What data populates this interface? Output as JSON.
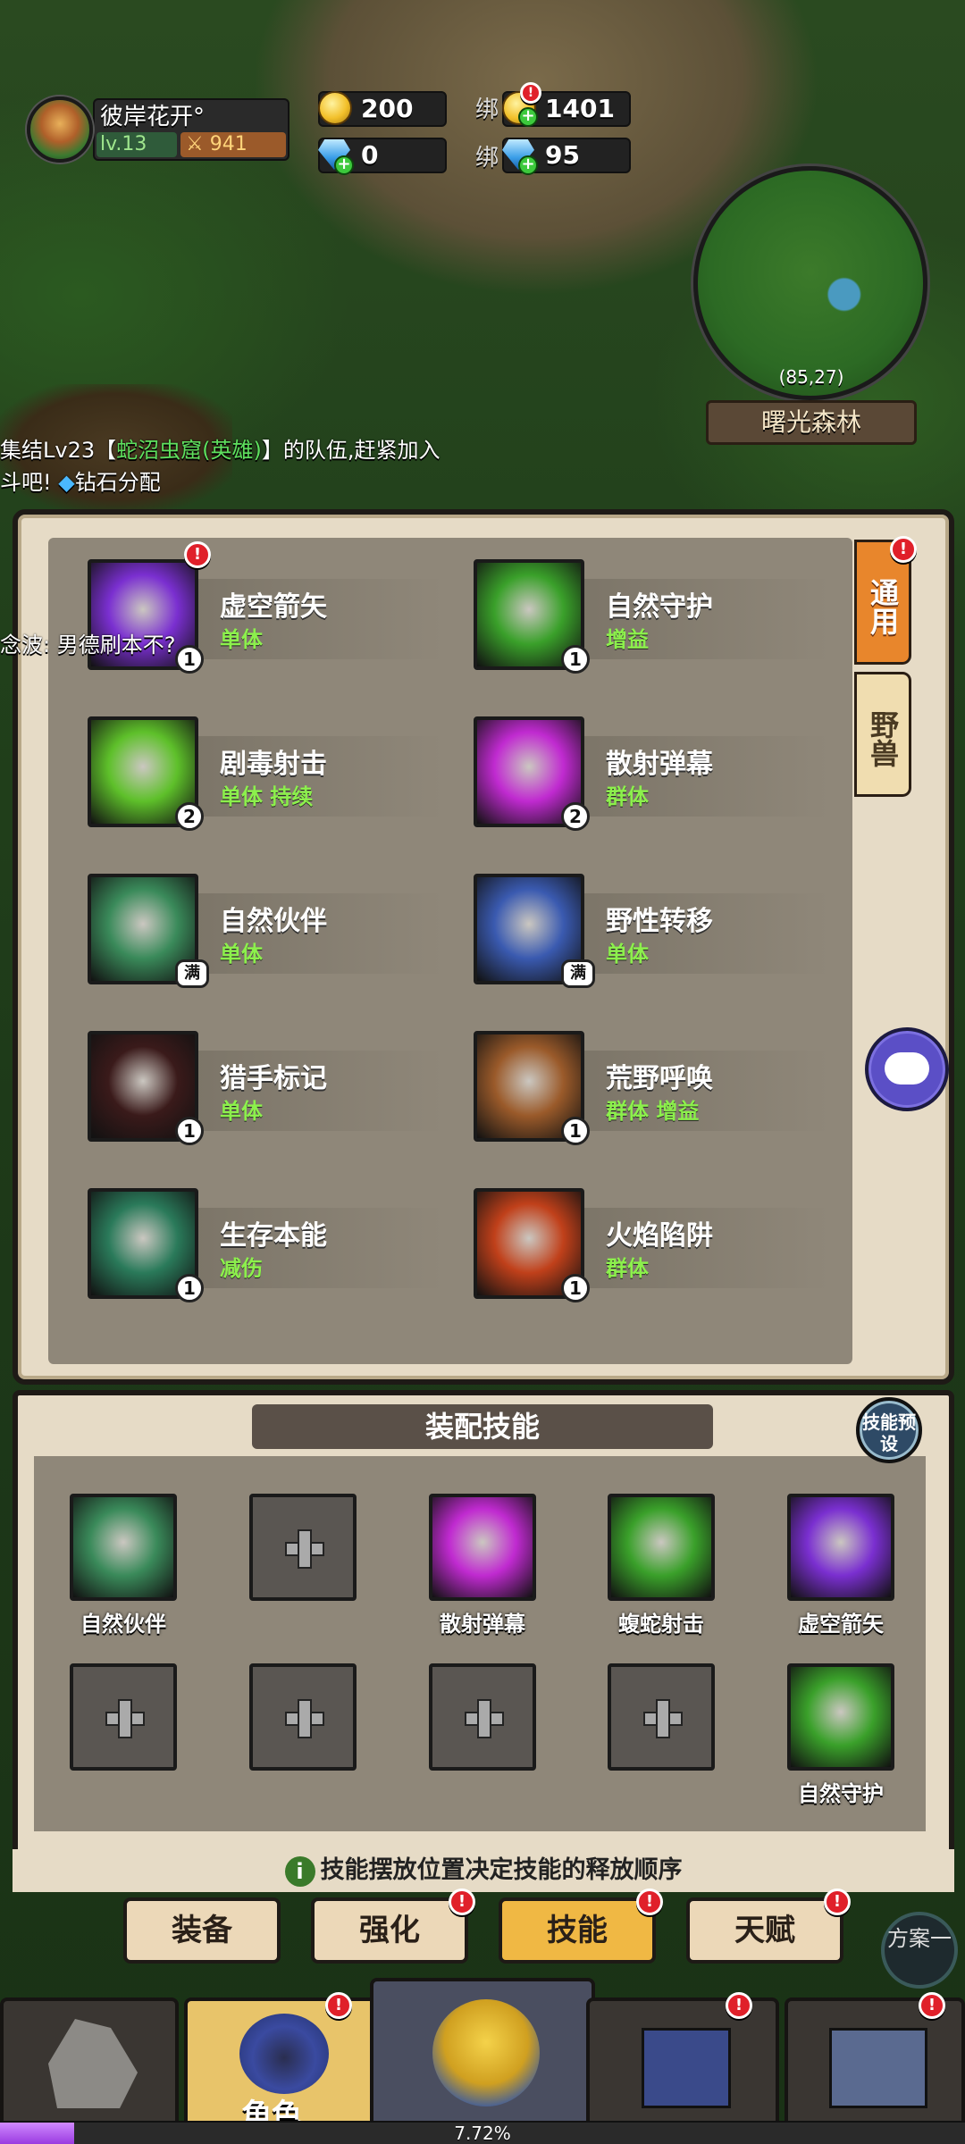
{
  "player": {
    "name": "彼岸花开°",
    "level": "lv.13",
    "power": "941"
  },
  "currency": {
    "gold": "200",
    "diamond": "0",
    "bound_label": "绑",
    "bound_gold": "1401",
    "bound_diamond": "95"
  },
  "map": {
    "coords": "(85,27)",
    "name": "曙光森林"
  },
  "chat": {
    "line1_prefix": "集结Lv23【",
    "line1_highlight": "蛇沼虫窟(英雄)",
    "line1_suffix": "】的队伍,赶紧加入",
    "line2_a": "斗吧!",
    "line2_b": "钻石分配",
    "line3": "念波: 男德刷本不?"
  },
  "side_tabs": [
    {
      "label": "通用"
    },
    {
      "label": "野兽"
    }
  ],
  "skills": [
    {
      "name": "虚空箭矢",
      "tags": "单体",
      "level": "1",
      "alert": true,
      "color": "#7a2fd0"
    },
    {
      "name": "自然守护",
      "tags": "增益",
      "level": "1",
      "alert": false,
      "color": "#3aa02a"
    },
    {
      "name": "剧毒射击",
      "tags": "单体 持续",
      "level": "2",
      "alert": false,
      "color": "#5ec02a"
    },
    {
      "name": "散射弹幕",
      "tags": "群体",
      "level": "2",
      "alert": false,
      "color": "#c02ad0"
    },
    {
      "name": "自然伙伴",
      "tags": "单体",
      "level": "满",
      "alert": false,
      "color": "#3a8a5a"
    },
    {
      "name": "野性转移",
      "tags": "单体",
      "level": "满",
      "alert": false,
      "color": "#3a5ab0"
    },
    {
      "name": "猎手标记",
      "tags": "单体",
      "level": "1",
      "alert": false,
      "color": "#3a1a1a"
    },
    {
      "name": "荒野呼唤",
      "tags": "群体 增益",
      "level": "1",
      "alert": false,
      "color": "#9a5a2a"
    },
    {
      "name": "生存本能",
      "tags": "减伤",
      "level": "1",
      "alert": false,
      "color": "#2a7a5a"
    },
    {
      "name": "火焰陷阱",
      "tags": "群体",
      "level": "1",
      "alert": false,
      "color": "#c0401a"
    }
  ],
  "equip": {
    "title": "装配技能",
    "preset_label": "技能预设",
    "slots": [
      {
        "label": "自然伙伴",
        "color": "#3a8a5a"
      },
      {
        "label": "",
        "color": ""
      },
      {
        "label": "散射弹幕",
        "color": "#c02ad0"
      },
      {
        "label": "蝮蛇射击",
        "color": "#3aa02a"
      },
      {
        "label": "虚空箭矢",
        "color": "#7a2fd0"
      },
      {
        "label": "",
        "color": ""
      },
      {
        "label": "",
        "color": ""
      },
      {
        "label": "",
        "color": ""
      },
      {
        "label": "",
        "color": ""
      },
      {
        "label": "自然守护",
        "color": "#3aa02a"
      }
    ],
    "hint": "技能摆放位置决定技能的释放顺序"
  },
  "bottom_tabs": [
    {
      "label": "装备"
    },
    {
      "label": "强化"
    },
    {
      "label": "技能"
    },
    {
      "label": "天赋"
    }
  ],
  "fangan": "方案一",
  "nav": {
    "role_label": "角色"
  },
  "xp": {
    "text": "7.72%",
    "fraction": 0.0772
  }
}
